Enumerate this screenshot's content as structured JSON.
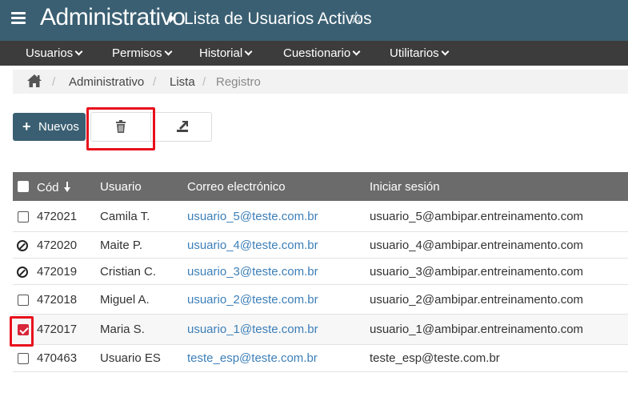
{
  "header": {
    "app_title": "Administrativo",
    "page_title": "Lista de Usuarios Activos",
    "favorite_icon": "star-outline-icon",
    "color": "#3a5f72"
  },
  "menu": {
    "items": [
      {
        "label": "Usuarios"
      },
      {
        "label": "Permisos"
      },
      {
        "label": "Historial"
      },
      {
        "label": "Cuestionario"
      },
      {
        "label": "Utilitarios"
      }
    ]
  },
  "breadcrumb": {
    "items": [
      {
        "label": "Administrativo"
      },
      {
        "label": "Lista"
      },
      {
        "label": "Registro"
      }
    ]
  },
  "toolbar": {
    "new_label": "Nuevos",
    "delete_icon": "trash-icon",
    "export_icon": "export-icon"
  },
  "table": {
    "headers": {
      "code": "Cód",
      "user": "Usuario",
      "email": "Correo electrónico",
      "login": "Iniciar sesión"
    },
    "rows": [
      {
        "status": "checkbox",
        "checked": false,
        "code": "472021",
        "user": "Camila T.",
        "email": "usuario_5@teste.com.br",
        "login": "usuario_5@ambipar.entreinamento.com"
      },
      {
        "status": "blocked",
        "checked": false,
        "code": "472020",
        "user": "Maite P.",
        "email": "usuario_4@teste.com.br",
        "login": "usuario_4@ambipar.entreinamento.com"
      },
      {
        "status": "blocked",
        "checked": false,
        "code": "472019",
        "user": "Cristian C.",
        "email": "usuario_3@teste.com.br",
        "login": "usuario_3@ambipar.entreinamento.com"
      },
      {
        "status": "checkbox",
        "checked": false,
        "code": "472018",
        "user": "Miguel A.",
        "email": "usuario_2@teste.com.br",
        "login": "usuario_2@ambipar.entreinamento.com"
      },
      {
        "status": "checkbox",
        "checked": true,
        "code": "472017",
        "user": "Maria S.",
        "email": "usuario_1@teste.com.br",
        "login": "usuario_1@ambipar.entreinamento.com"
      },
      {
        "status": "checkbox",
        "checked": false,
        "code": "470463",
        "user": "Usuario ES",
        "email": "teste_esp@teste.com.br",
        "login": "teste_esp@teste.com.br"
      }
    ]
  }
}
